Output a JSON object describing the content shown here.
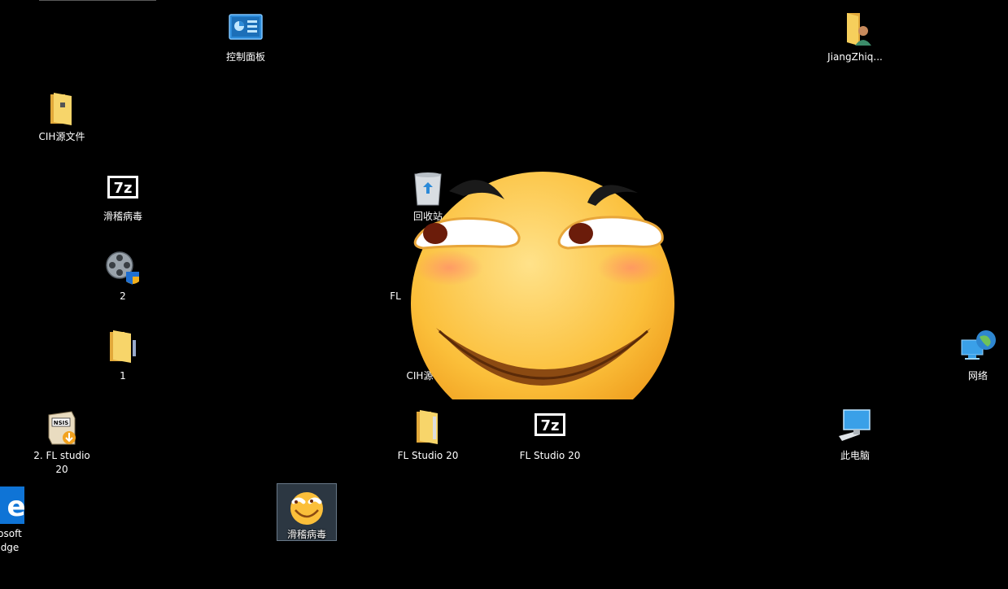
{
  "desktop": {
    "icons": {
      "control_panel": {
        "label": "控制面板",
        "icon": "control-panel-icon"
      },
      "user_folder": {
        "label": "JiangZhiq...",
        "icon": "user-folder-icon"
      },
      "cih_source_left": {
        "label": "CIH源文件",
        "icon": "folder-icon"
      },
      "zip_virus": {
        "label": "滑稽病毒",
        "icon": "7zip-archive-icon"
      },
      "recycle_bin": {
        "label": "回收站",
        "icon": "recycle-bin-icon"
      },
      "installer_2": {
        "label": "2",
        "icon": "film-reel-installer-icon"
      },
      "fl_hidden": {
        "label": "FL",
        "icon": "fl-studio-icon"
      },
      "folder_1": {
        "label": "1",
        "icon": "folder-icon"
      },
      "cih_source_mid": {
        "label": "CIH源",
        "icon": "folder-icon"
      },
      "network": {
        "label": "网络",
        "icon": "network-globe-icon"
      },
      "nsis_fl": {
        "label": "2. FL studio 20",
        "icon": "nsis-installer-icon"
      },
      "fl_folder": {
        "label": "FL Studio 20",
        "icon": "folder-icon"
      },
      "fl_zip": {
        "label": "FL Studio 20",
        "icon": "7zip-archive-icon"
      },
      "this_pc": {
        "label": "此电脑",
        "icon": "computer-monitor-icon"
      },
      "edge": {
        "label": "osoft\ndge",
        "icon": "edge-icon"
      },
      "huaji_exe": {
        "label": "滑稽病毒",
        "icon": "huaji-face-icon"
      }
    },
    "selected_icon": "滑稽病毒",
    "colors": {
      "background": "#000000",
      "folder": "#f4c542",
      "face": "#fbbf3a",
      "selection": "#4f6478"
    }
  }
}
